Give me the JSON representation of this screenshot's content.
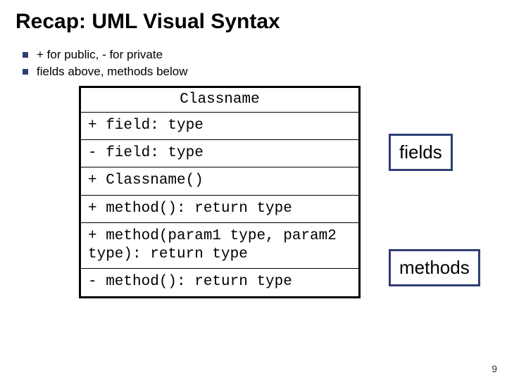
{
  "title": "Recap: UML Visual Syntax",
  "bullets": [
    "+ for public, - for private",
    "fields above, methods below"
  ],
  "uml": {
    "classname": "Classname",
    "fields": [
      "+ field: type",
      "- field: type"
    ],
    "methods": [
      "+ Classname()",
      "+ method(): return type",
      "+ method(param1 type, param2 type): return type",
      "- method(): return type"
    ]
  },
  "labels": {
    "fields": "fields",
    "methods": "methods"
  },
  "page_number": "9"
}
